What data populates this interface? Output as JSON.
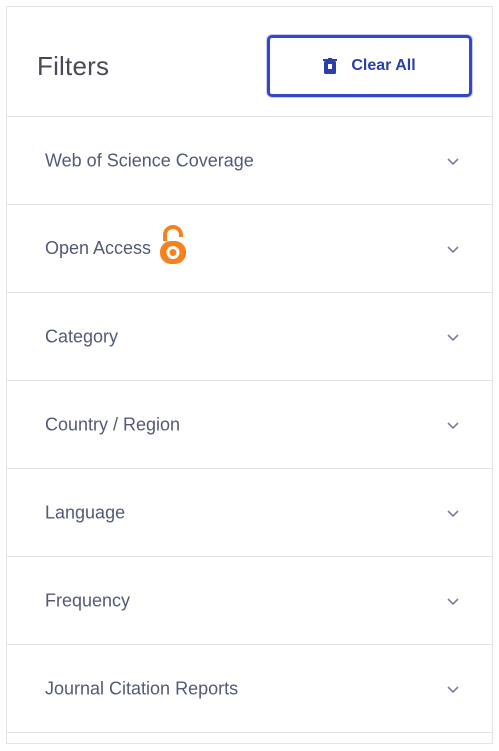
{
  "filters": {
    "title": "Filters",
    "clear_all_label": "Clear All",
    "items": [
      {
        "label": "Web of Science Coverage",
        "icon": "chevron-down-icon"
      },
      {
        "label": "Open Access",
        "icon": "chevron-down-icon",
        "badge_icon": "open-access-lock-icon"
      },
      {
        "label": "Category",
        "icon": "chevron-down-icon"
      },
      {
        "label": "Country / Region",
        "icon": "chevron-down-icon"
      },
      {
        "label": "Language",
        "icon": "chevron-down-icon"
      },
      {
        "label": "Frequency",
        "icon": "chevron-down-icon"
      },
      {
        "label": "Journal Citation Reports",
        "icon": "chevron-down-icon"
      }
    ]
  },
  "colors": {
    "accent": "#3248c8",
    "open_access": "#f58220",
    "text": "#525a78"
  }
}
